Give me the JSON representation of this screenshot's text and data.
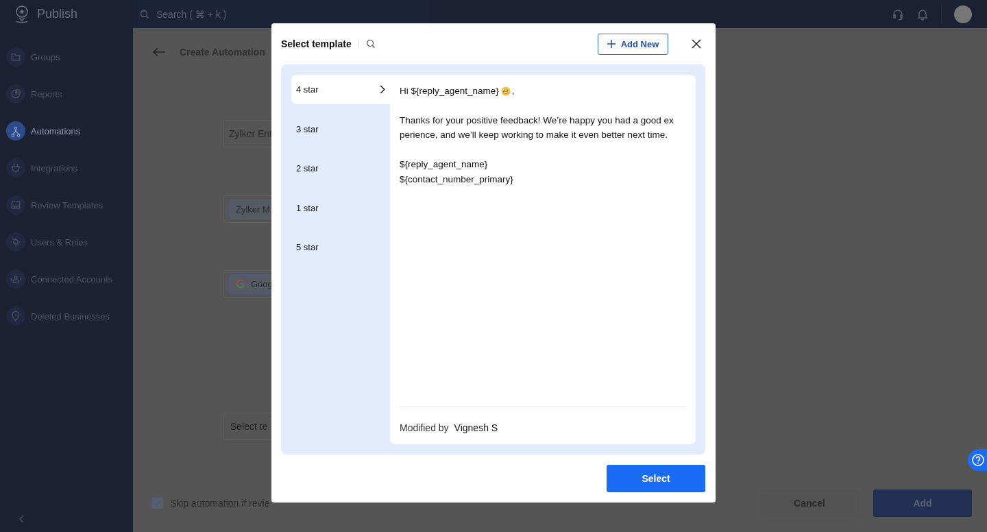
{
  "app": {
    "name": "Publish"
  },
  "search": {
    "placeholder": "Search ( ⌘ + k )"
  },
  "sidebar": {
    "items": [
      {
        "label": "Groups",
        "selected": false
      },
      {
        "label": "Reports",
        "selected": false
      },
      {
        "label": "Automations",
        "selected": true
      },
      {
        "label": "Integrations",
        "selected": false
      },
      {
        "label": "Review Templates",
        "selected": false
      },
      {
        "label": "Users & Roles",
        "selected": false
      },
      {
        "label": "Connected Accounts",
        "selected": false
      },
      {
        "label": "Deleted Businesses",
        "selected": false
      }
    ]
  },
  "page": {
    "title": "Create Automation",
    "fields": [
      {
        "kind": "text",
        "value": "Zylker Ent"
      },
      {
        "kind": "chip",
        "value": "Zylker M"
      },
      {
        "kind": "google_chip",
        "value": "Goog"
      },
      {
        "kind": "empty",
        "placeholder": "Select te"
      }
    ],
    "skip_option": {
      "label": "Skip automation if revie",
      "checked": true
    },
    "buttons": [
      {
        "label": "Cancel",
        "kind": "secondary"
      },
      {
        "label": "Add",
        "kind": "primary"
      }
    ]
  },
  "dialog": {
    "title": "Select template",
    "add_button": "Add New",
    "templates": [
      {
        "label": "4 star",
        "selected": true
      },
      {
        "label": "3 star",
        "selected": false
      },
      {
        "label": "2 star",
        "selected": false
      },
      {
        "label": "1 star",
        "selected": false
      },
      {
        "label": "5 star",
        "selected": false
      }
    ],
    "message": {
      "greeting": "Hi ${reply_agent_name}",
      "greeting_end": ",",
      "paragraphs": [
        [
          "Thanks for your positive feedback! We’re happy you had a good ex",
          "perience, and we’ll keep working to make it even better next time."
        ],
        [
          "${reply_agent_name}",
          "${contact_number_primary}"
        ]
      ]
    },
    "modified_label": "Modified by",
    "modified_by": "Vignesh S",
    "select_button": "Select"
  }
}
